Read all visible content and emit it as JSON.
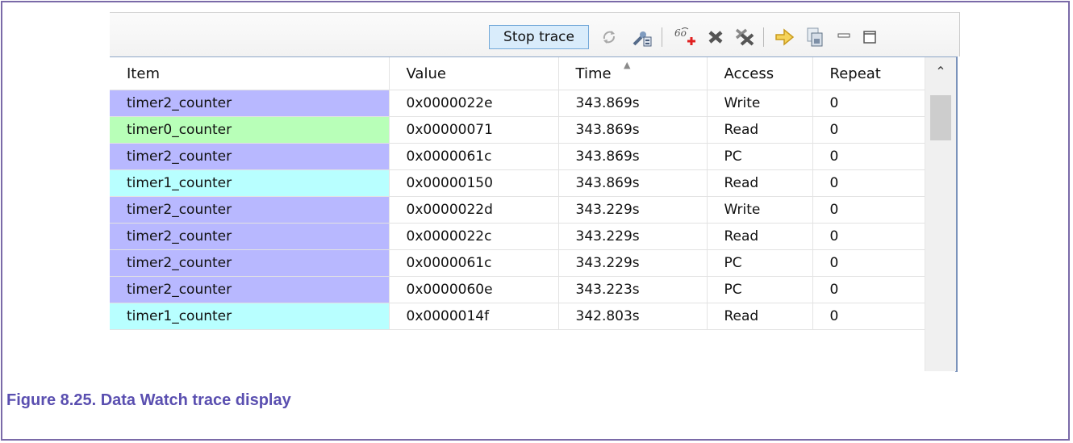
{
  "toolbar": {
    "stop_trace_label": "Stop trace",
    "icons": [
      "sync-icon",
      "search-device-icon",
      "add-trace-icon",
      "remove-icon",
      "remove-all-icon",
      "export-icon",
      "copy-icon",
      "minimize-icon",
      "maximize-icon"
    ]
  },
  "table": {
    "columns": [
      "Item",
      "Value",
      "Time",
      "Access",
      "Repeat"
    ],
    "sorted_column": "Time",
    "rows": [
      {
        "item": "timer2_counter",
        "value": "0x0000022e",
        "time": "343.869s",
        "access": "Write",
        "repeat": "0",
        "color": "#b8b8ff"
      },
      {
        "item": "timer0_counter",
        "value": "0x00000071",
        "time": "343.869s",
        "access": "Read",
        "repeat": "0",
        "color": "#b8ffb8"
      },
      {
        "item": "timer2_counter",
        "value": "0x0000061c",
        "time": "343.869s",
        "access": "PC",
        "repeat": "0",
        "color": "#b8b8ff"
      },
      {
        "item": "timer1_counter",
        "value": "0x00000150",
        "time": "343.869s",
        "access": "Read",
        "repeat": "0",
        "color": "#b8ffff"
      },
      {
        "item": "timer2_counter",
        "value": "0x0000022d",
        "time": "343.229s",
        "access": "Write",
        "repeat": "0",
        "color": "#b8b8ff"
      },
      {
        "item": "timer2_counter",
        "value": "0x0000022c",
        "time": "343.229s",
        "access": "Read",
        "repeat": "0",
        "color": "#b8b8ff"
      },
      {
        "item": "timer2_counter",
        "value": "0x0000061c",
        "time": "343.229s",
        "access": "PC",
        "repeat": "0",
        "color": "#b8b8ff"
      },
      {
        "item": "timer2_counter",
        "value": "0x0000060e",
        "time": "343.223s",
        "access": "PC",
        "repeat": "0",
        "color": "#b8b8ff"
      },
      {
        "item": "timer1_counter",
        "value": "0x0000014f",
        "time": "342.803s",
        "access": "Read",
        "repeat": "0",
        "color": "#b8ffff"
      }
    ]
  },
  "caption": "Figure 8.25. Data Watch trace display",
  "colors": {
    "caption": "#5a4fb0",
    "frame": "#7a6aa8",
    "stop_button_bg": "#d9ecfb"
  }
}
